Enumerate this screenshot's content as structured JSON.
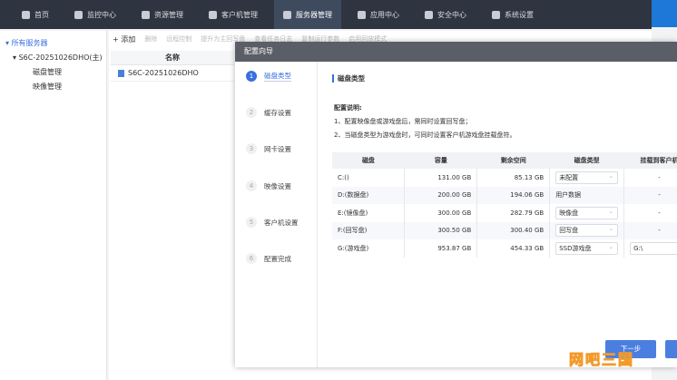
{
  "nav": {
    "items": [
      {
        "label": "首页",
        "icon": "home-icon"
      },
      {
        "label": "监控中心",
        "icon": "monitor-icon"
      },
      {
        "label": "资源管理",
        "icon": "resource-icon"
      },
      {
        "label": "客户机管理",
        "icon": "client-icon"
      },
      {
        "label": "服务器管理",
        "icon": "server-icon",
        "active": true
      },
      {
        "label": "应用中心",
        "icon": "app-icon"
      },
      {
        "label": "安全中心",
        "icon": "shield-icon"
      },
      {
        "label": "系统设置",
        "icon": "gear-icon"
      }
    ]
  },
  "sidebar": {
    "root": "所有服务器",
    "server": "S6C-20251026DHO(主)",
    "children": [
      "磁盘管理",
      "映像管理"
    ]
  },
  "toolbar": [
    "+ 添加",
    "删除",
    "远程控制",
    "提升为主回写盘",
    "查看任务日志",
    "复制运行参数",
    "启用回放模式"
  ],
  "list": {
    "header": "名称",
    "rows": [
      "S6C-20251026DHO"
    ]
  },
  "modal": {
    "title": "配置向导",
    "steps": [
      "磁盘类型",
      "缓存设置",
      "网卡设置",
      "映像设置",
      "客户机设置",
      "配置完成"
    ],
    "section": "磁盘类型",
    "note_title": "配置说明:",
    "notes": [
      "1、配置映像盘或游戏盘后，需同时设置回写盘；",
      "2、当磁盘类型为游戏盘时，可同时设置客户机游戏盘挂载盘符。"
    ],
    "columns": [
      "磁盘",
      "容量",
      "剩余空间",
      "磁盘类型",
      "挂载到客户机"
    ],
    "rows": [
      [
        "C:()",
        "131.00 GB",
        "85.13 GB",
        "未配置",
        "-"
      ],
      [
        "D:(数据盘)",
        "200.00 GB",
        "194.06 GB",
        "用户数据",
        "-"
      ],
      [
        "E:(镜像盘)",
        "300.00 GB",
        "282.79 GB",
        "映像盘",
        "-"
      ],
      [
        "F:(回写盘)",
        "300.50 GB",
        "300.40 GB",
        "回写盘",
        "-"
      ],
      [
        "G:(游戏盘)",
        "953.87 GB",
        "454.33 GB",
        "SSD游戏盘",
        "G:\\"
      ]
    ],
    "next": "下一步"
  },
  "watermark": "网吧三国"
}
